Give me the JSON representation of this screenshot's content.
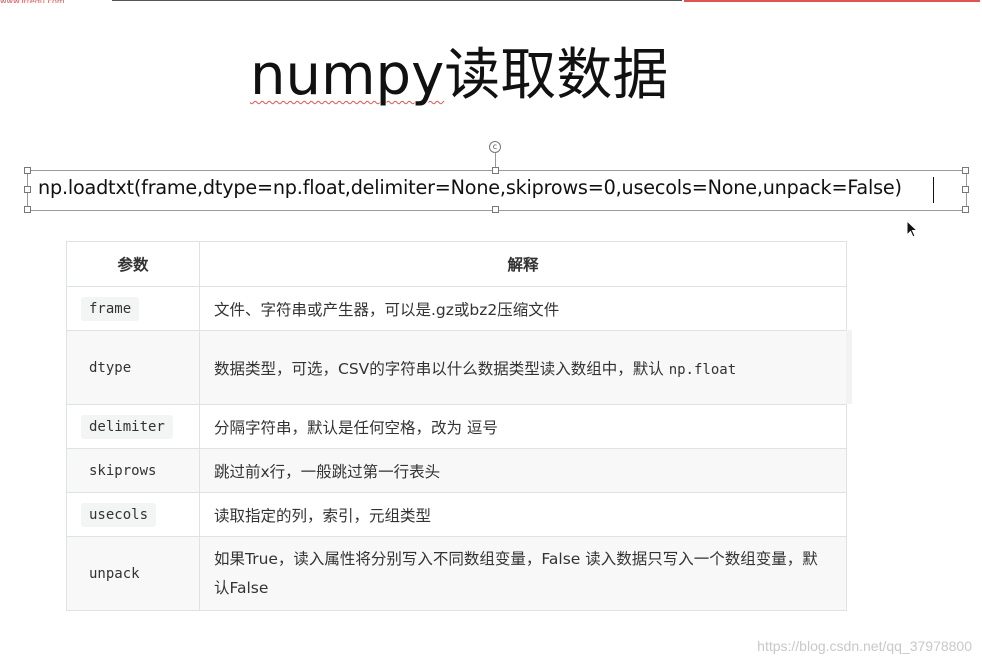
{
  "header": {
    "left_mark": "www.ittedu.com"
  },
  "title": {
    "english": "numpy",
    "chinese": "读取数据"
  },
  "code_line": "np.loadtxt(frame,dtype=np.float,delimiter=None,skiprows=0,usecols=None,unpack=False)",
  "table": {
    "headers": [
      "参数",
      "解释"
    ],
    "rows": [
      {
        "param": "frame",
        "desc": "文件、字符串或产生器，可以是.gz或bz2压缩文件",
        "code": ""
      },
      {
        "param": "dtype",
        "desc": "数据类型，可选，CSV的字符串以什么数据类型读入数组中，默认 ",
        "code": "np.float"
      },
      {
        "param": "delimiter",
        "desc": "分隔字符串，默认是任何空格，改为 逗号",
        "code": ""
      },
      {
        "param": "skiprows",
        "desc": "跳过前x行，一般跳过第一行表头",
        "code": ""
      },
      {
        "param": "usecols",
        "desc": "读取指定的列，索引，元组类型",
        "code": ""
      },
      {
        "param": "unpack",
        "desc": "如果True，读入属性将分别写入不同数组变量，False 读入数据只写入一个数组变量，默认False",
        "code": ""
      }
    ]
  },
  "watermark": "https://blog.csdn.net/qq_37978800"
}
